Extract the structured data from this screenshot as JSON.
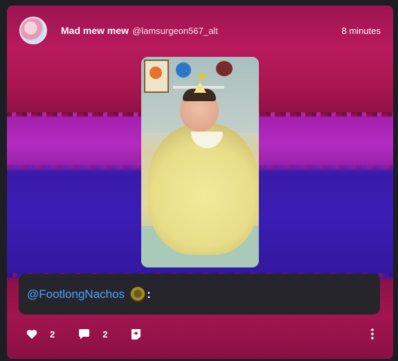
{
  "post": {
    "display_name": "Mad mew mew",
    "handle": "@lamsurgeon567_alt",
    "time": "8 minutes",
    "caption": {
      "mention": "@FootlongNachos",
      "emoji_icon": "custom-emoji-icon",
      "suffix": ":"
    }
  },
  "actions": {
    "likes": "2",
    "comments": "2"
  },
  "colors": {
    "mention": "#4aa3ff",
    "caption_bg": "#26252c",
    "band_pink": "#b81a5c",
    "band_purple": "#b22cc0",
    "band_blue": "#3b1db4"
  }
}
